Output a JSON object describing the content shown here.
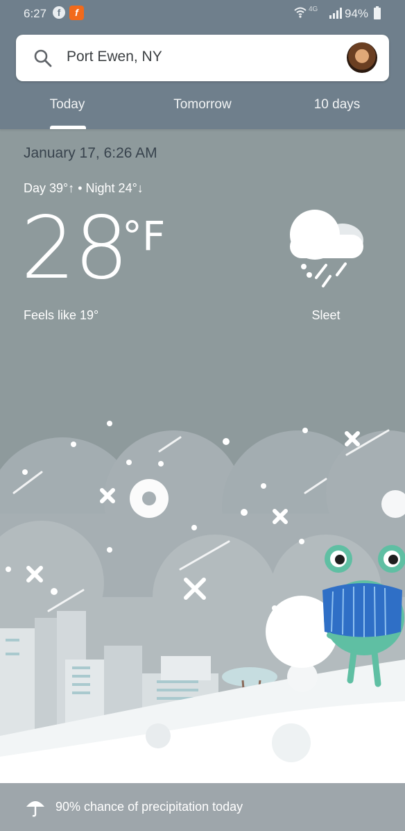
{
  "status_bar": {
    "time": "6:27",
    "network": "4G",
    "battery": "94%",
    "icons": [
      "facebook-icon",
      "app-icon",
      "wifi-icon",
      "signal-icon",
      "battery-icon"
    ]
  },
  "search": {
    "location": "Port Ewen, NY",
    "icon": "search-icon"
  },
  "tabs": {
    "today": "Today",
    "tomorrow": "Tomorrow",
    "ten_days": "10 days"
  },
  "weather": {
    "date": "January 17, 6:26 AM",
    "day_night": "Day 39°↑ • Night 24°↓",
    "temperature": "28",
    "unit": "°F",
    "feels_like": "Feels like 19°",
    "condition": "Sleet",
    "condition_icon": "sleet-icon"
  },
  "precipitation": {
    "text": "90% chance of precipitation today",
    "icon": "umbrella-icon"
  },
  "colors": {
    "header_bg": "#6f7f8c",
    "body_bg": "#8e9a9c",
    "accent": "#ffffff"
  }
}
